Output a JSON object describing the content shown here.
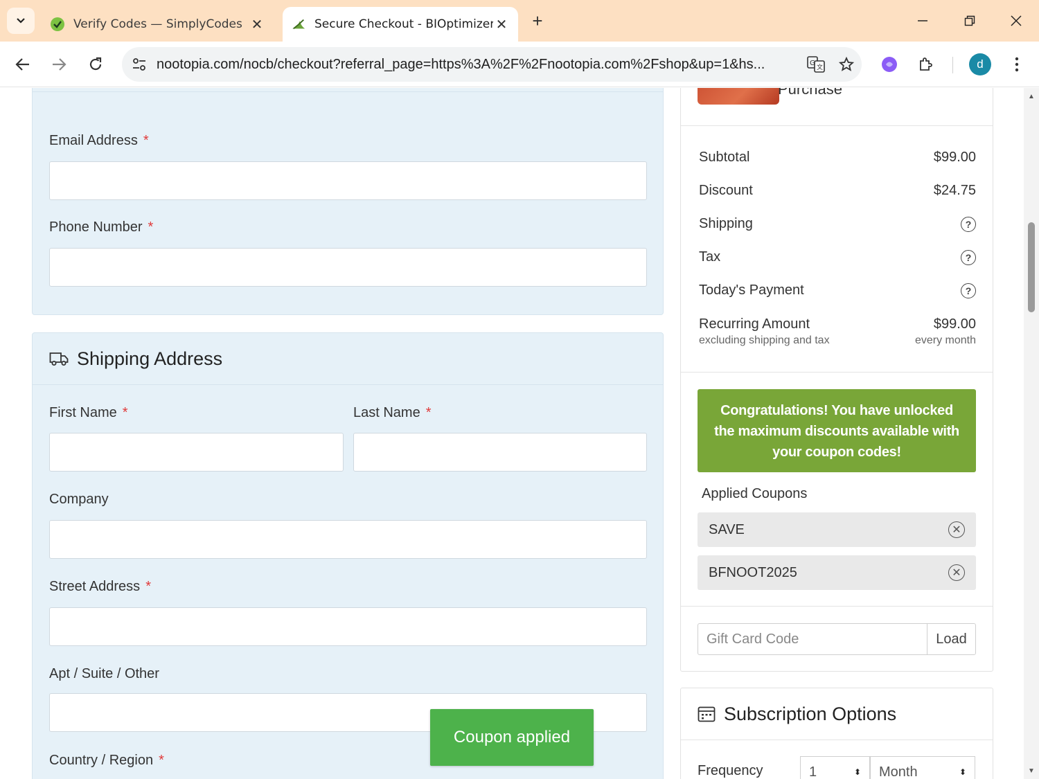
{
  "browser": {
    "tabs": [
      {
        "title": "Verify Codes — SimplyCodes",
        "active": false
      },
      {
        "title": "Secure Checkout - BIOptimizers",
        "active": true
      }
    ],
    "url": "nootopia.com/nocb/checkout?referral_page=https%3A%2F%2Fnootopia.com%2Fshop&up=1&hs...",
    "profile_initial": "d"
  },
  "contact": {
    "email_label": "Email Address",
    "phone_label": "Phone Number",
    "required_mark": "*"
  },
  "shipping": {
    "title": "Shipping Address",
    "first_name_label": "First Name",
    "last_name_label": "Last Name",
    "company_label": "Company",
    "street_label": "Street Address",
    "apt_label": "Apt / Suite / Other",
    "country_label": "Country / Region",
    "required_mark": "*"
  },
  "summary": {
    "product_caption": "Purchase",
    "rows": [
      {
        "label": "Subtotal",
        "value": "$99.00"
      },
      {
        "label": "Discount",
        "value": "$24.75"
      },
      {
        "label": "Shipping",
        "value": "?"
      },
      {
        "label": "Tax",
        "value": "?"
      },
      {
        "label": "Today's Payment",
        "value": "?"
      }
    ],
    "recurring": {
      "label": "Recurring Amount",
      "value": "$99.00",
      "note": "excluding shipping and tax",
      "period": "every month"
    },
    "congrats": "Congratulations! You have unlocked the maximum discounts available with your coupon codes!",
    "applied_title": "Applied Coupons",
    "coupons": [
      "SAVE",
      "BFNOOT2025"
    ],
    "gift_placeholder": "Gift Card Code",
    "load_label": "Load"
  },
  "subscription": {
    "title": "Subscription Options",
    "frequency_label": "Frequency",
    "frequency_value": "1",
    "frequency_unit": "Month"
  },
  "toast": {
    "message": "Coupon applied"
  },
  "colors": {
    "tabbar": "#fde0c2",
    "panel_bg": "#e6f1f8",
    "congrats_bg": "#79a638",
    "toast_bg": "#4db24b",
    "required": "#e03a3a"
  }
}
